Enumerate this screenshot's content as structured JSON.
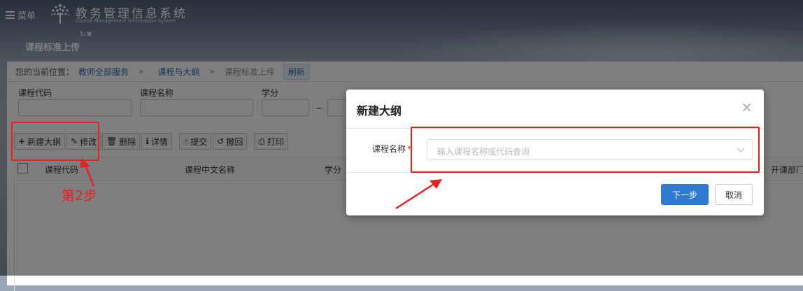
{
  "colors": {
    "accent": "#2f7bd1",
    "annotation": "#e32222"
  },
  "topbar": {
    "menu_label": "菜单",
    "system_title": "教务管理信息系统",
    "system_subtitle": "Course Management Information System"
  },
  "tab": {
    "tools": "↻✖"
  },
  "page": {
    "title": "课程标准上传"
  },
  "breadcrumb": {
    "label": "您的当前位置：",
    "items": [
      "教师全部服务",
      "课程与大纲",
      "课程标准上传"
    ],
    "separator": "»",
    "refresh": "刷新"
  },
  "filters": [
    {
      "label": "课程代码"
    },
    {
      "label": "课程名称"
    },
    {
      "label": "学分"
    }
  ],
  "filters_tilde": "~",
  "toolbar": {
    "new": "新建大纲",
    "edit": "修改",
    "delete": "删除",
    "detail": "详情",
    "submit": "提交",
    "withdraw": "撤回",
    "print": "打印"
  },
  "table": {
    "headers": [
      "课程代码",
      "课程中文名称",
      "学分",
      "开课部门"
    ]
  },
  "annotation": {
    "step_label": "第2步"
  },
  "modal": {
    "title": "新建大纲",
    "close": "×",
    "field_label": "课程名称",
    "required_mark": "*",
    "placeholder": "输入课程名称或代码查询",
    "next_label": "下一步",
    "cancel_label": "取消"
  }
}
